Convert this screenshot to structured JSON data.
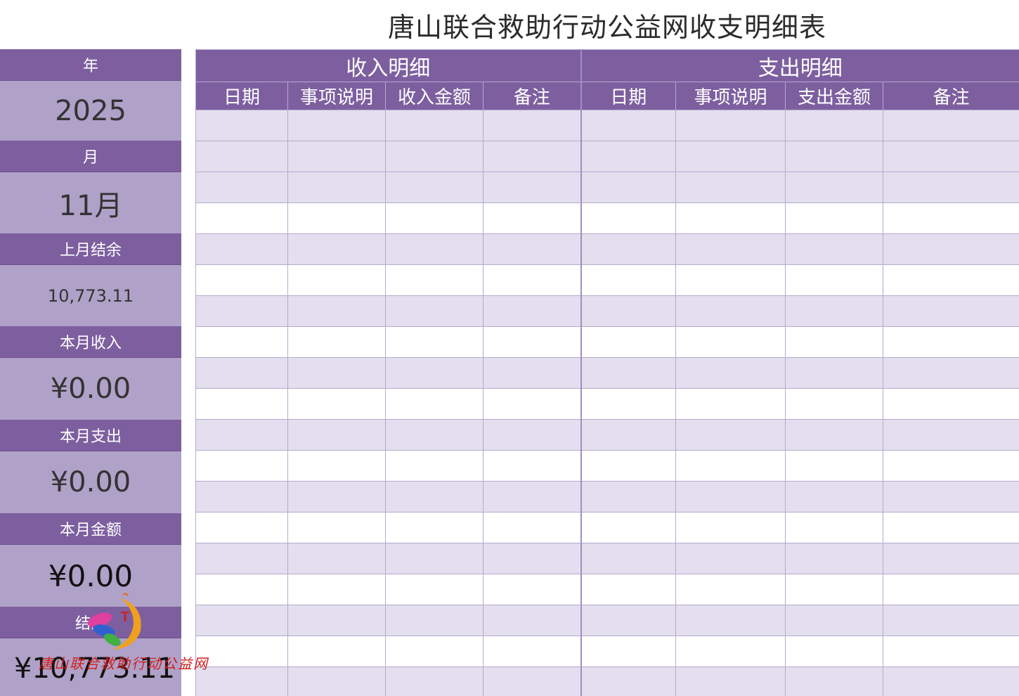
{
  "title": "唐山联合救助行动公益网收支明细表",
  "summary": {
    "year_label": "年",
    "year_value": "2025",
    "month_label": "月",
    "month_value": "11月",
    "last_balance_label": "上月结余",
    "last_balance_value": "10,773.11",
    "income_label": "本月收入",
    "income_value": "¥0.00",
    "expense_label": "本月支出",
    "expense_value": "¥0.00",
    "amount_label": "本月金额",
    "amount_value": "¥0.00",
    "balance_label": "结余",
    "balance_value": "¥10,773.11"
  },
  "table": {
    "income_section": "收入明细",
    "expense_section": "支出明细",
    "income_columns": [
      "日期",
      "事项说明",
      "收入金额",
      "备注"
    ],
    "expense_columns": [
      "日期",
      "事项说明",
      "支出金额",
      "备注"
    ],
    "row_count": 19
  },
  "watermark": {
    "text": "唐山联合救助行动公益网",
    "logo_letter": "T"
  },
  "colors": {
    "header_purple": "#7d5fa0",
    "panel_value": "#b0a1c8",
    "row_stripe": "#e3dfee"
  }
}
